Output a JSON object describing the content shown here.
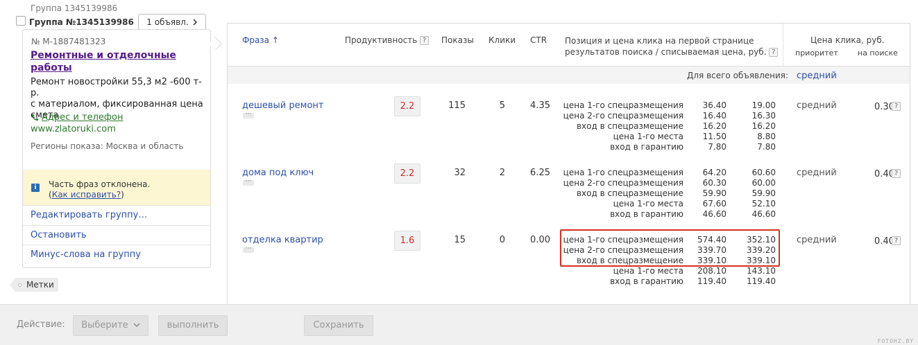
{
  "group": {
    "small_label": "Группа 1345139986",
    "title": "Группа №1345139986",
    "ads_button": "1 объявл."
  },
  "ad": {
    "number": "№ M-1887481323",
    "title_line1": "Ремонтные и отделочные",
    "title_line2": "работы",
    "text_line1": "Ремонт новостройки 55,3 м2 -600 т-р.",
    "text_line2": "с материалом, фиксированная цена",
    "text_line3": "смета",
    "contacts_link": "Адрес и телефон",
    "url": "www.zlatoruki.com",
    "regions": "Регионы показа: Москва и область"
  },
  "warning": {
    "text": "Часть фраз отклонена.",
    "link_open": "(",
    "link": "Как исправить?",
    "link_close": ")"
  },
  "card_links": [
    "Редактировать группу…",
    "Остановить",
    "Минус-слова на группу"
  ],
  "tag_button": "Метки",
  "table": {
    "headers": {
      "phrase": "Фраза",
      "sort_arrow": "↑",
      "productivity": "Продуктивность",
      "shows": "Показы",
      "clicks": "Клики",
      "ctr": "CTR",
      "position_line1": "Позиция и цена клика на первой странице",
      "position_line2": "результатов поиска / списываемая цена, руб.",
      "bid": "Цена клика, руб.",
      "bid_priority": "приоритет",
      "bid_search": "на поиске",
      "help": "?"
    },
    "all_ads_label": "Для всего объявления:",
    "all_ads_value": "средний",
    "rows": [
      {
        "phrase": "дешевый ремонт",
        "productivity": "2.2",
        "shows": "115",
        "clicks": "5",
        "ctr": "4.35",
        "labels": [
          "цена 1-го спецразмещения",
          "цена 2-го спецразмещения",
          "вход в спецразмещение",
          "цена 1-го места",
          "вход в гарантию"
        ],
        "v1": [
          "36.40",
          "16.40",
          "16.20",
          "11.50",
          "7.80"
        ],
        "v2": [
          "19.00",
          "16.30",
          "16.20",
          "8.80",
          "7.80"
        ],
        "priority": "средний",
        "bid": "0.30"
      },
      {
        "phrase": "дома под ключ",
        "productivity": "2.2",
        "shows": "32",
        "clicks": "2",
        "ctr": "6.25",
        "labels": [
          "цена 1-го спецразмещения",
          "цена 2-го спецразмещения",
          "вход в спецразмещение",
          "цена 1-го места",
          "вход в гарантию"
        ],
        "v1": [
          "64.20",
          "60.30",
          "59.90",
          "67.60",
          "46.60"
        ],
        "v2": [
          "60.60",
          "60.00",
          "59.90",
          "52.10",
          "46.60"
        ],
        "priority": "средний",
        "bid": "0.40"
      },
      {
        "phrase": "отделка квартир",
        "productivity": "1.6",
        "shows": "15",
        "clicks": "0",
        "ctr": "0.00",
        "labels": [
          "цена 1-го спецразмещения",
          "цена 2-го спецразмещения",
          "вход в спецразмещение",
          "цена 1-го места",
          "вход в гарантию"
        ],
        "v1": [
          "574.40",
          "339.70",
          "339.10",
          "208.10",
          "119.40"
        ],
        "v2": [
          "352.10",
          "339.20",
          "339.10",
          "143.10",
          "119.40"
        ],
        "priority": "средний",
        "bid": "0.40"
      }
    ]
  },
  "footer": {
    "label": "Действие:",
    "select": "Выберите",
    "run": "выполнить",
    "save": "Сохранить"
  },
  "watermark": "FOTOHZ.BY",
  "colors": {
    "link": "#2b4fa8",
    "productivity_red": "#d62b2b",
    "highlight_border": "#d6301f",
    "warning_bg": "#fdf6d3"
  }
}
